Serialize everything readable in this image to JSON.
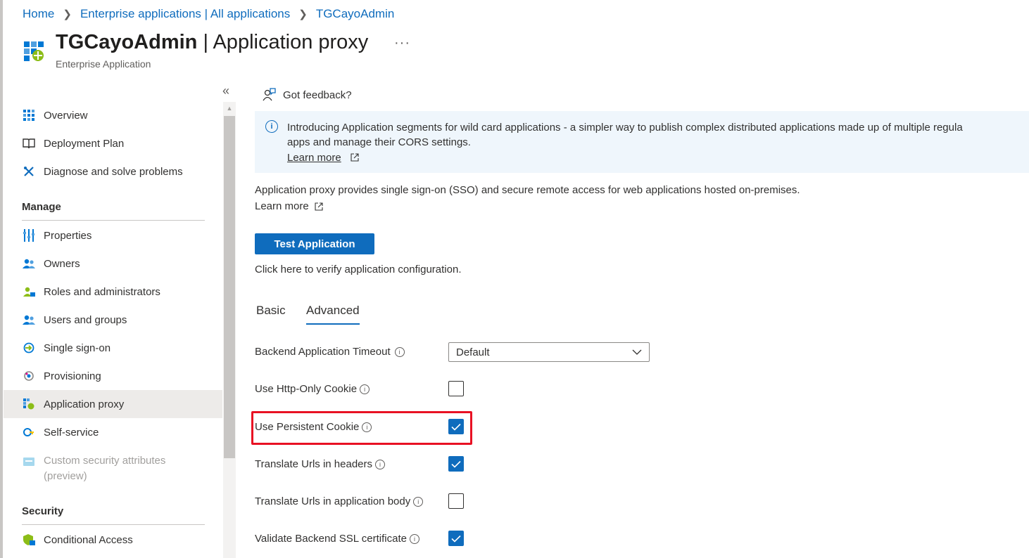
{
  "breadcrumb": {
    "items": [
      "Home",
      "Enterprise applications | All applications",
      "TGCayoAdmin"
    ]
  },
  "header": {
    "app_name": "TGCayoAdmin",
    "separator": " | ",
    "page_name": "Application proxy",
    "subtitle": "Enterprise Application",
    "more": "···"
  },
  "sidebar": {
    "collapse": "«",
    "top_items": [
      {
        "label": "Overview",
        "icon": "overview-grid-icon"
      },
      {
        "label": "Deployment Plan",
        "icon": "book-icon"
      },
      {
        "label": "Diagnose and solve problems",
        "icon": "wrench-icon"
      }
    ],
    "manage_header": "Manage",
    "manage_items": [
      {
        "label": "Properties",
        "icon": "properties-icon"
      },
      {
        "label": "Owners",
        "icon": "owners-icon"
      },
      {
        "label": "Roles and administrators",
        "icon": "roles-icon"
      },
      {
        "label": "Users and groups",
        "icon": "users-groups-icon"
      },
      {
        "label": "Single sign-on",
        "icon": "sso-icon"
      },
      {
        "label": "Provisioning",
        "icon": "provisioning-icon"
      },
      {
        "label": "Application proxy",
        "icon": "app-proxy-icon",
        "active": true
      },
      {
        "label": "Self-service",
        "icon": "self-service-icon"
      },
      {
        "label": "Custom security attributes",
        "label2": "(preview)",
        "icon": "custom-attributes-icon",
        "disabled": true
      }
    ],
    "security_header": "Security",
    "security_items": [
      {
        "label": "Conditional Access",
        "icon": "conditional-access-icon"
      }
    ]
  },
  "main": {
    "feedback": "Got feedback?",
    "banner": {
      "line1": "Introducing Application segments for wild card applications - a simpler way to publish complex distributed applications made up of multiple regula",
      "line2": "apps and manage their CORS settings.",
      "learn_more": "Learn more",
      "info_glyph": "i"
    },
    "description": "Application proxy provides single sign-on (SSO) and secure remote access for web applications hosted on-premises.",
    "learn_more": "Learn more",
    "test_button": "Test Application",
    "test_hint": "Click here to verify application configuration.",
    "tabs": [
      {
        "label": "Basic",
        "active": false
      },
      {
        "label": "Advanced",
        "active": true
      }
    ],
    "settings": {
      "backend_timeout": {
        "label": "Backend Application Timeout",
        "value": "Default"
      },
      "http_only_cookie": {
        "label": "Use Http-Only Cookie",
        "checked": false
      },
      "persistent_cookie": {
        "label": "Use Persistent Cookie",
        "checked": true
      },
      "translate_headers": {
        "label": "Translate Urls in headers",
        "checked": true
      },
      "translate_body": {
        "label": "Translate Urls in application body",
        "checked": false
      },
      "validate_ssl": {
        "label": "Validate Backend SSL certificate",
        "checked": true
      }
    }
  },
  "colors": {
    "accent": "#0f6cbd",
    "highlight": "#e81123",
    "banner_bg": "#eff6fc",
    "active_nav": "#edebe9"
  }
}
